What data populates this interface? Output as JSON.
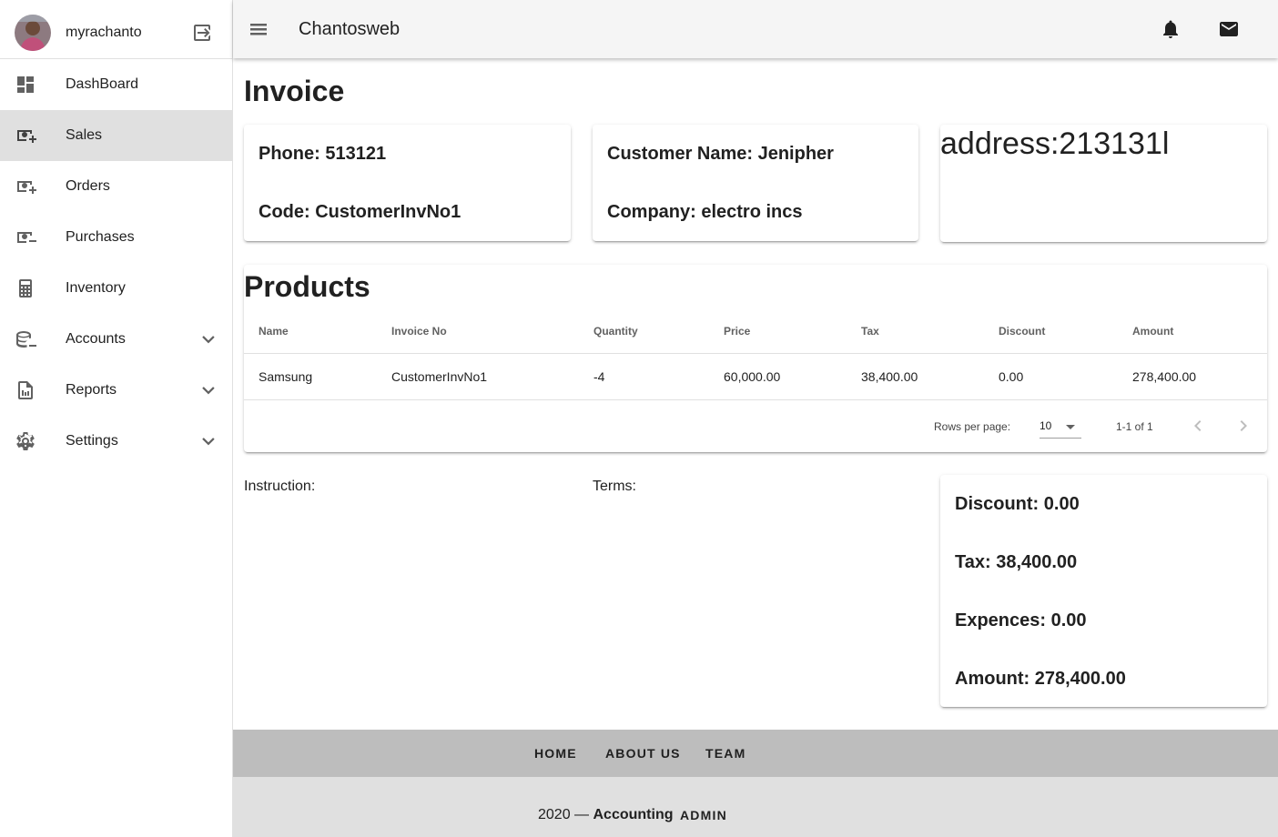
{
  "sidebar": {
    "username": "myrachanto",
    "items": [
      {
        "label": "DashBoard",
        "icon": "dashboard-icon"
      },
      {
        "label": "Sales",
        "icon": "cash-plus-icon",
        "active": true
      },
      {
        "label": "Orders",
        "icon": "cash-plus-icon"
      },
      {
        "label": "Purchases",
        "icon": "cash-minus-icon"
      },
      {
        "label": "Inventory",
        "icon": "calculator-icon"
      },
      {
        "label": "Accounts",
        "icon": "database-minus-icon",
        "expandable": true
      },
      {
        "label": "Reports",
        "icon": "report-file-icon",
        "expandable": true
      },
      {
        "label": "Settings",
        "icon": "gear-icon",
        "expandable": true
      }
    ]
  },
  "topbar": {
    "title": "Chantosweb"
  },
  "invoice": {
    "heading": "Invoice",
    "phone": "Phone: 513121",
    "code": "Code: CustomerInvNo1",
    "customer_name": "Customer Name: Jenipher",
    "company": "Company: electro incs",
    "address": "address:213131l"
  },
  "products": {
    "heading": "Products",
    "columns": [
      "Name",
      "Invoice No",
      "Quantity",
      "Price",
      "Tax",
      "Discount",
      "Amount"
    ],
    "rows": [
      [
        "Samsung",
        "CustomerInvNo1",
        "-4",
        "60,000.00",
        "38,400.00",
        "0.00",
        "278,400.00"
      ]
    ],
    "pagination": {
      "rows_per_page_label": "Rows per page:",
      "rows_per_page": "10",
      "range": "1-1 of 1"
    }
  },
  "notes": {
    "instruction": "Instruction:",
    "terms": "Terms:"
  },
  "totals": {
    "discount": "Discount: 0.00",
    "tax": "Tax: 38,400.00",
    "expences": "Expences: 0.00",
    "amount": "Amount: 278,400.00"
  },
  "footer": {
    "links": [
      "HOME",
      "ABOUT US",
      "TEAM"
    ],
    "year": "2020 —",
    "brand": "Accounting",
    "admin": "ADMIN"
  },
  "colors": {
    "topbar_bg": "#f5f5f5",
    "active_nav_bg": "#e0e0e0",
    "footer_nav_bg": "#bdbdbd",
    "footer_bottom_bg": "#e0e0e0",
    "icon_color": "#616161"
  }
}
